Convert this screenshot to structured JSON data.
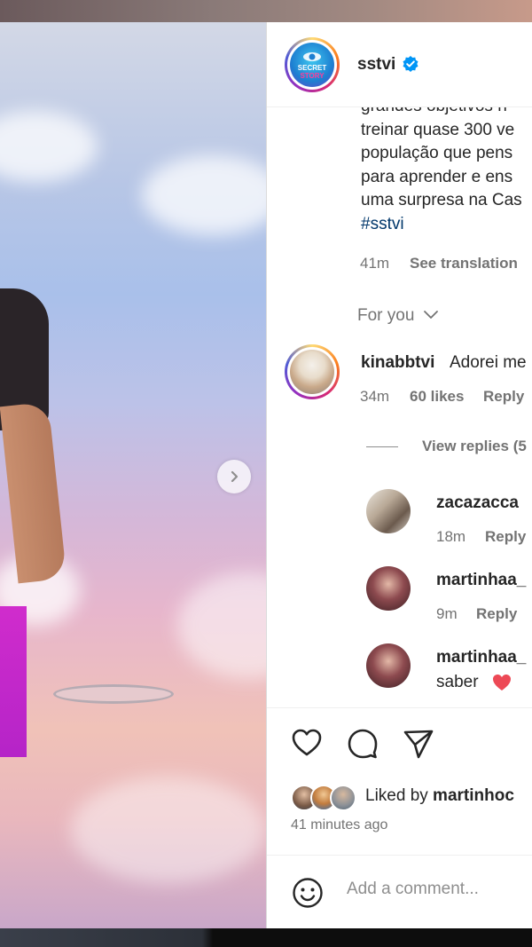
{
  "post": {
    "author": "sstvi",
    "author_avatar_text": "SECRET STORY",
    "caption_lines": [
      "grandes objetivos n",
      "treinar quase 300 ve",
      "população que pens",
      "para aprender e ens",
      "uma surpresa na Cas"
    ],
    "hashtag": "#sstvi",
    "time": "41m",
    "see_translation": "See translation",
    "for_you": "For you"
  },
  "comments": [
    {
      "user": "kinabbtvi",
      "text": "Adorei me",
      "time": "34m",
      "likes": "60 likes",
      "reply": "Reply"
    }
  ],
  "view_replies": "View replies (5",
  "replies": [
    {
      "user": "zacazacca",
      "time": "18m",
      "reply": "Reply"
    },
    {
      "user": "martinhaa_",
      "time": "9m",
      "reply": "Reply"
    },
    {
      "user": "martinhaa_",
      "text": "saber"
    }
  ],
  "footer": {
    "liked_by_prefix": "Liked by ",
    "liked_by_user": "martinhoc",
    "time_ago": "41 minutes ago",
    "add_comment_placeholder": "Add a comment..."
  },
  "colors": {
    "verified": "#0095f6",
    "heart_emoji": "#ed4956"
  },
  "icons": [
    "chevron-right-icon",
    "verified-icon",
    "chevron-down-icon",
    "heart-icon",
    "comment-icon",
    "share-icon",
    "emoji-icon",
    "heart-emoji-icon"
  ]
}
